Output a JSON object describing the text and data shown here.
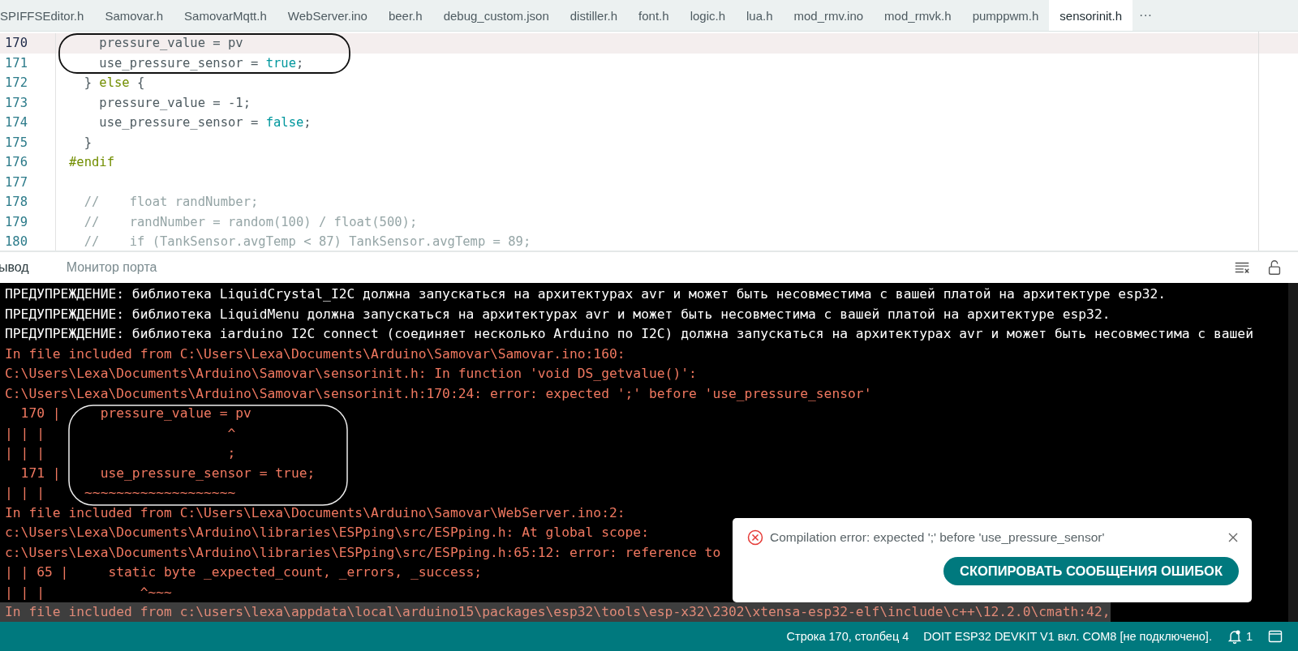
{
  "tabs": [
    {
      "label": "SPIFFSEditor.h",
      "selected": false
    },
    {
      "label": "Samovar.h",
      "selected": false
    },
    {
      "label": "SamovarMqtt.h",
      "selected": false
    },
    {
      "label": "WebServer.ino",
      "selected": false
    },
    {
      "label": "beer.h",
      "selected": false
    },
    {
      "label": "debug_custom.json",
      "selected": false
    },
    {
      "label": "distiller.h",
      "selected": false
    },
    {
      "label": "font.h",
      "selected": false
    },
    {
      "label": "logic.h",
      "selected": false
    },
    {
      "label": "lua.h",
      "selected": false
    },
    {
      "label": "mod_rmv.ino",
      "selected": false
    },
    {
      "label": "mod_rmvk.h",
      "selected": false
    },
    {
      "label": "pumppwm.h",
      "selected": false
    },
    {
      "label": "sensorinit.h",
      "selected": true
    }
  ],
  "more_tabs": "···",
  "editor": {
    "lines": [
      {
        "number": "170",
        "current": true,
        "tokens": [
          {
            "text": "    pressure_value = pv",
            "kind": "plain"
          }
        ]
      },
      {
        "number": "171",
        "current": false,
        "tokens": [
          {
            "text": "    use_pressure_sensor = ",
            "kind": "plain"
          },
          {
            "text": "true",
            "kind": "constant"
          },
          {
            "text": ";",
            "kind": "plain"
          }
        ]
      },
      {
        "number": "172",
        "current": false,
        "tokens": [
          {
            "text": "  } ",
            "kind": "plain"
          },
          {
            "text": "else",
            "kind": "keyword"
          },
          {
            "text": " {",
            "kind": "plain"
          }
        ]
      },
      {
        "number": "173",
        "current": false,
        "tokens": [
          {
            "text": "    pressure_value = -1;",
            "kind": "plain"
          }
        ]
      },
      {
        "number": "174",
        "current": false,
        "tokens": [
          {
            "text": "    use_pressure_sensor = ",
            "kind": "plain"
          },
          {
            "text": "false",
            "kind": "constant"
          },
          {
            "text": ";",
            "kind": "plain"
          }
        ]
      },
      {
        "number": "175",
        "current": false,
        "tokens": [
          {
            "text": "  }",
            "kind": "plain"
          }
        ]
      },
      {
        "number": "176",
        "current": false,
        "tokens": [
          {
            "text": "#endif",
            "kind": "keyword"
          }
        ]
      },
      {
        "number": "177",
        "current": false
      },
      {
        "number": "178",
        "current": false,
        "tokens": [
          {
            "text": "  //    float randNumber;",
            "kind": "comment"
          }
        ]
      },
      {
        "number": "179",
        "current": false,
        "tokens": [
          {
            "text": "  //    randNumber = random(100) / float(500);",
            "kind": "comment"
          }
        ]
      },
      {
        "number": "180",
        "current": false,
        "tokens": [
          {
            "text": "  //    if (TankSensor.avgTemp < 87) TankSensor.avgTemp = 89;",
            "kind": "comment"
          }
        ]
      }
    ]
  },
  "output": {
    "tabs": [
      {
        "label": "ывод",
        "selected": true
      },
      {
        "label": "Монитор порта",
        "selected": false
      }
    ],
    "lines": [
      {
        "kind": "warning",
        "text": "ПРЕДУПРЕЖДЕНИЕ: библиотека LiquidCrystal_I2C должна запускаться на архитектурах avr и может быть несовместима с вашей платой на архитектуре esp32."
      },
      {
        "kind": "warning",
        "text": "ПРЕДУПРЕЖДЕНИЕ: библиотека LiquidMenu должна запускаться на архитектурах avr и может быть несовместима с вашей платой на архитектуре esp32."
      },
      {
        "kind": "warning",
        "text": "ПРЕДУПРЕЖДЕНИЕ: библиотека iarduino I2C connect (соединяет несколько Arduino по I2C) должна запускаться на архитектурах avr и может быть несовместима с вашей"
      },
      {
        "kind": "error",
        "text": "In file included from C:\\Users\\Lexa\\Documents\\Arduino\\Samovar\\Samovar.ino:160:"
      },
      {
        "kind": "error",
        "text": "C:\\Users\\Lexa\\Documents\\Arduino\\Samovar\\sensorinit.h: In function 'void DS_getvalue()':"
      },
      {
        "kind": "error",
        "text": "C:\\Users\\Lexa\\Documents\\Arduino\\Samovar\\sensorinit.h:170:24: error: expected ';' before 'use_pressure_sensor'"
      },
      {
        "kind": "error",
        "text": "  170 |     pressure_value = pv"
      },
      {
        "kind": "error",
        "text": "| | |                       ^"
      },
      {
        "kind": "error",
        "text": "| | |                       ;"
      },
      {
        "kind": "error",
        "text": "  171 |     use_pressure_sensor = true;"
      },
      {
        "kind": "error",
        "text": "| | |     ~~~~~~~~~~~~~~~~~~~"
      },
      {
        "kind": "error",
        "text": "In file included from C:\\Users\\Lexa\\Documents\\Arduino\\Samovar\\WebServer.ino:2:"
      },
      {
        "kind": "error",
        "text": "c:\\Users\\Lexa\\Documents\\Arduino\\libraries\\ESPping\\src/ESPping.h: At global scope:"
      },
      {
        "kind": "error",
        "text": "c:\\Users\\Lexa\\Documents\\Arduino\\libraries\\ESPping\\src/ESPping.h:65:12: error: reference to"
      },
      {
        "kind": "error",
        "text": "| | 65 |     static byte _expected_count, _errors, _success;"
      },
      {
        "kind": "error",
        "text": "| | |            ^~~~"
      },
      {
        "kind": "faded",
        "text": "In file included from c:\\users\\lexa\\appdata\\local\\arduino15\\packages\\esp32\\tools\\esp-x32\\2302\\xtensa-esp32-elf\\include\\c++\\12.2.0\\cmath:42,"
      }
    ]
  },
  "toast": {
    "message": "Compilation error: expected ';' before 'use_pressure_sensor'",
    "button": "СКОПИРОВАТЬ СООБЩЕНИЯ ОШИБОК"
  },
  "status_bar": {
    "position": "Строка 170, столбец 4",
    "board": "DOIT ESP32 DEVKIT V1 вкл. COM8 [не подключено].",
    "notifications": "1"
  }
}
